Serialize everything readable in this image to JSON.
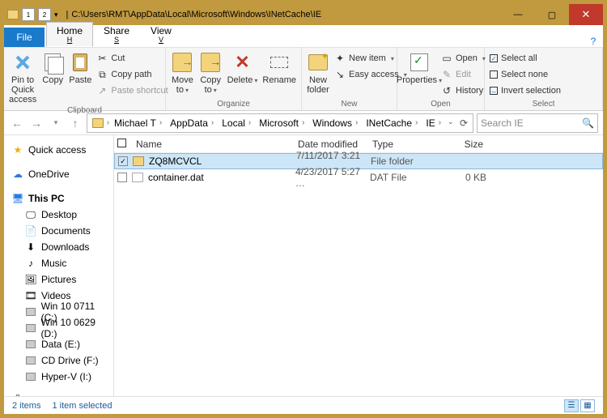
{
  "window": {
    "path_title": "C:\\Users\\RMT\\AppData\\Local\\Microsoft\\Windows\\INetCache\\IE",
    "qat_badges": [
      "1",
      "2"
    ]
  },
  "tabs": {
    "file": "File",
    "home": {
      "label": "Home",
      "key": "H"
    },
    "share": {
      "label": "Share",
      "key": "S"
    },
    "view": {
      "label": "View",
      "key": "V"
    }
  },
  "ribbon": {
    "pin_label": "Pin to Quick access",
    "copy": "Copy",
    "paste": "Paste",
    "cut": "Cut",
    "copy_path": "Copy path",
    "paste_shortcut": "Paste shortcut",
    "clipboard_group": "Clipboard",
    "move_to": "Move to",
    "copy_to": "Copy to",
    "delete": "Delete",
    "rename": "Rename",
    "organize_group": "Organize",
    "new_folder": "New folder",
    "new_item": "New item",
    "easy_access": "Easy access",
    "new_group": "New",
    "properties": "Properties",
    "open": "Open",
    "edit": "Edit",
    "history": "History",
    "open_group": "Open",
    "select_all": "Select all",
    "select_none": "Select none",
    "invert_selection": "Invert selection",
    "select_group": "Select"
  },
  "breadcrumb": [
    "Michael T",
    "AppData",
    "Local",
    "Microsoft",
    "Windows",
    "INetCache",
    "IE"
  ],
  "search_placeholder": "Search IE",
  "columns": {
    "name": "Name",
    "modified": "Date modified",
    "type": "Type",
    "size": "Size"
  },
  "rows": [
    {
      "selected": true,
      "icon": "folder",
      "name": "ZQ8MCVCL",
      "modified": "7/11/2017 3:21 …",
      "type": "File folder",
      "size": ""
    },
    {
      "selected": false,
      "icon": "dat",
      "name": "container.dat",
      "modified": "4/23/2017 5:27 …",
      "type": "DAT File",
      "size": "0 KB"
    }
  ],
  "sidebar": {
    "quick_access": "Quick access",
    "onedrive": "OneDrive",
    "this_pc": "This PC",
    "items": [
      "Desktop",
      "Documents",
      "Downloads",
      "Music",
      "Pictures",
      "Videos"
    ],
    "drives": [
      "Win 10 0711 (C:)",
      "Win 10 0629 (D:)",
      "Data (E:)",
      "CD Drive (F:)",
      "Hyper-V (I:)"
    ],
    "network": "Network"
  },
  "status": {
    "count": "2 items",
    "selected": "1 item selected"
  }
}
